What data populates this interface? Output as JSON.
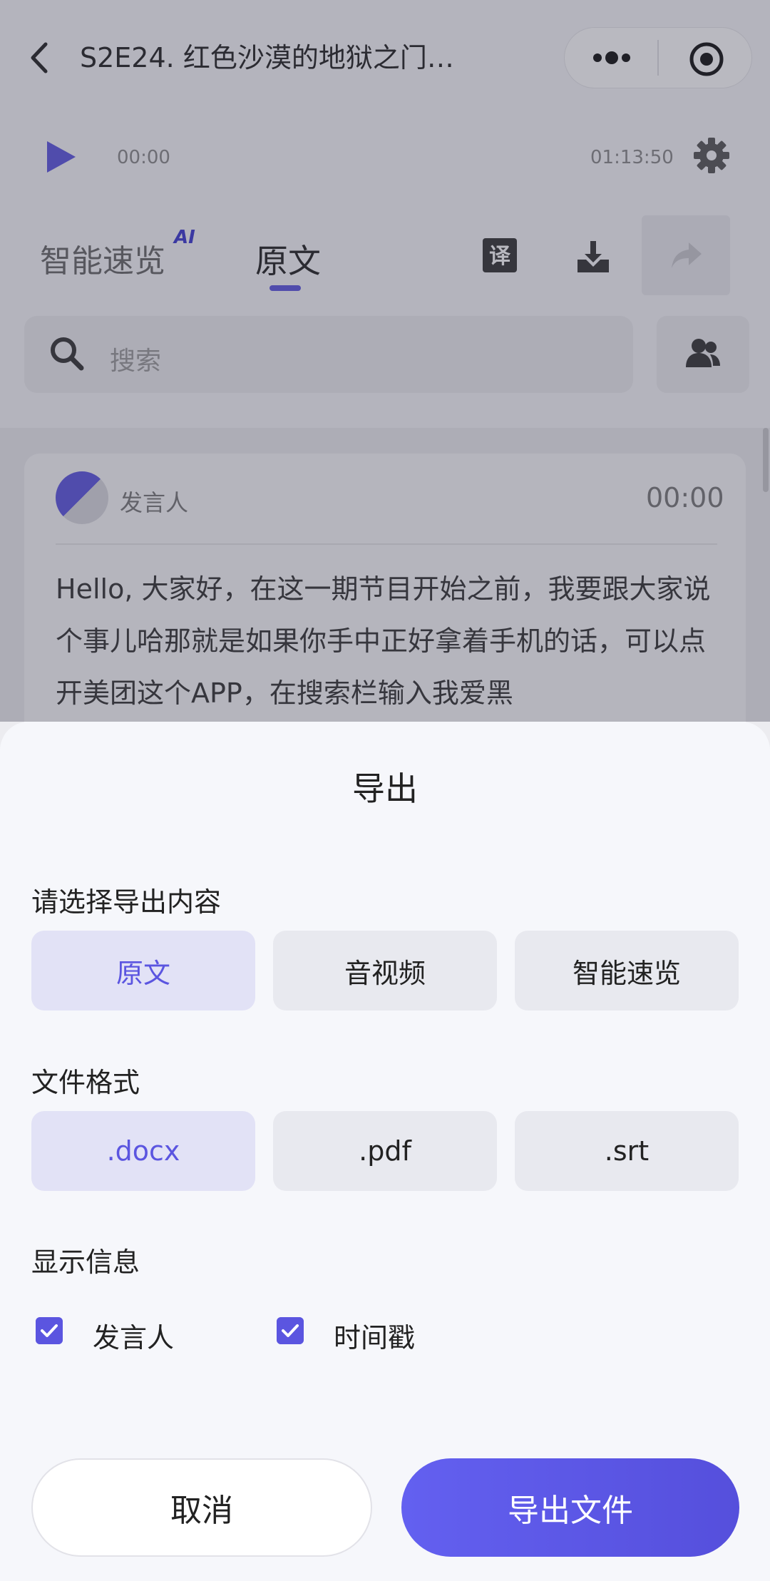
{
  "header": {
    "title": "S2E24. 红色沙漠的地狱之门…"
  },
  "player": {
    "time_start": "00:00",
    "time_end": "01:13:50"
  },
  "tabs": {
    "smart": "智能速览",
    "ai_badge": "AI",
    "original": "原文"
  },
  "search": {
    "placeholder": "搜索"
  },
  "transcript": {
    "speaker": "发言人",
    "time": "00:00",
    "text": "Hello, 大家好，在这一期节目开始之前，我要跟大家说个事儿哈那就是如果你手中正好拿着手机的话，可以点开美团这个APP，在搜索栏输入我爱黑"
  },
  "sheet": {
    "title": "导出",
    "content_label": "请选择导出内容",
    "content_options": [
      "原文",
      "音视频",
      "智能速览"
    ],
    "format_label": "文件格式",
    "format_options": [
      ".docx",
      ".pdf",
      ".srt"
    ],
    "info_label": "显示信息",
    "info_options": [
      "发言人",
      "时间戳"
    ],
    "cancel": "取消",
    "export": "导出文件"
  },
  "colors": {
    "accent": "#5b55e0",
    "selected_bg": "#e2e2f6"
  }
}
